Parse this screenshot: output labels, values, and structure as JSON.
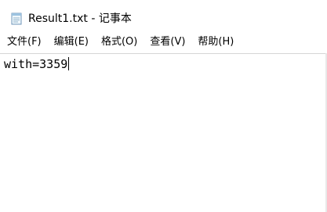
{
  "window": {
    "title": "Result1.txt - 记事本",
    "icon": "notepad-icon"
  },
  "menu": [
    {
      "label": "文件(F)"
    },
    {
      "label": "编辑(E)"
    },
    {
      "label": "格式(O)"
    },
    {
      "label": "查看(V)"
    },
    {
      "label": "帮助(H)"
    }
  ],
  "document": {
    "content": "with=3359"
  }
}
